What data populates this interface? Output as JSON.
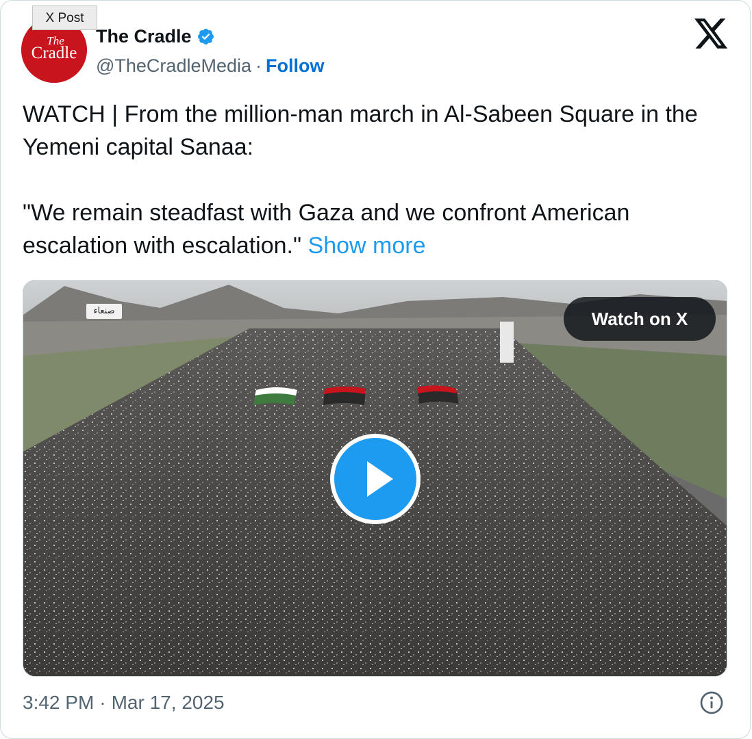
{
  "embed": {
    "tag_label": "X Post"
  },
  "author": {
    "avatar_text_top": "The",
    "avatar_text_bottom": "Cradle",
    "display_name": "The Cradle",
    "handle": "@TheCradleMedia",
    "separator": "·",
    "follow_label": "Follow",
    "verified": true
  },
  "tweet": {
    "paragraph_1": "WATCH | From the million-man march in Al-Sabeen Square in the Yemeni capital Sanaa:",
    "paragraph_2": "\"We remain steadfast with Gaza and we confront American escalation with escalation.\" ",
    "show_more_label": "Show more"
  },
  "media": {
    "overlay_city_label": "صنعاء",
    "watch_label": "Watch on X",
    "play_icon": "play-icon"
  },
  "footer": {
    "time": "3:42 PM",
    "separator": "·",
    "date": "Mar 17, 2025",
    "info_icon": "info-icon"
  },
  "colors": {
    "link_blue": "#1d9bf0",
    "follow_blue": "#006fd6",
    "brand_red": "#c8141c",
    "text_primary": "#0f1419",
    "text_secondary": "#536471"
  }
}
